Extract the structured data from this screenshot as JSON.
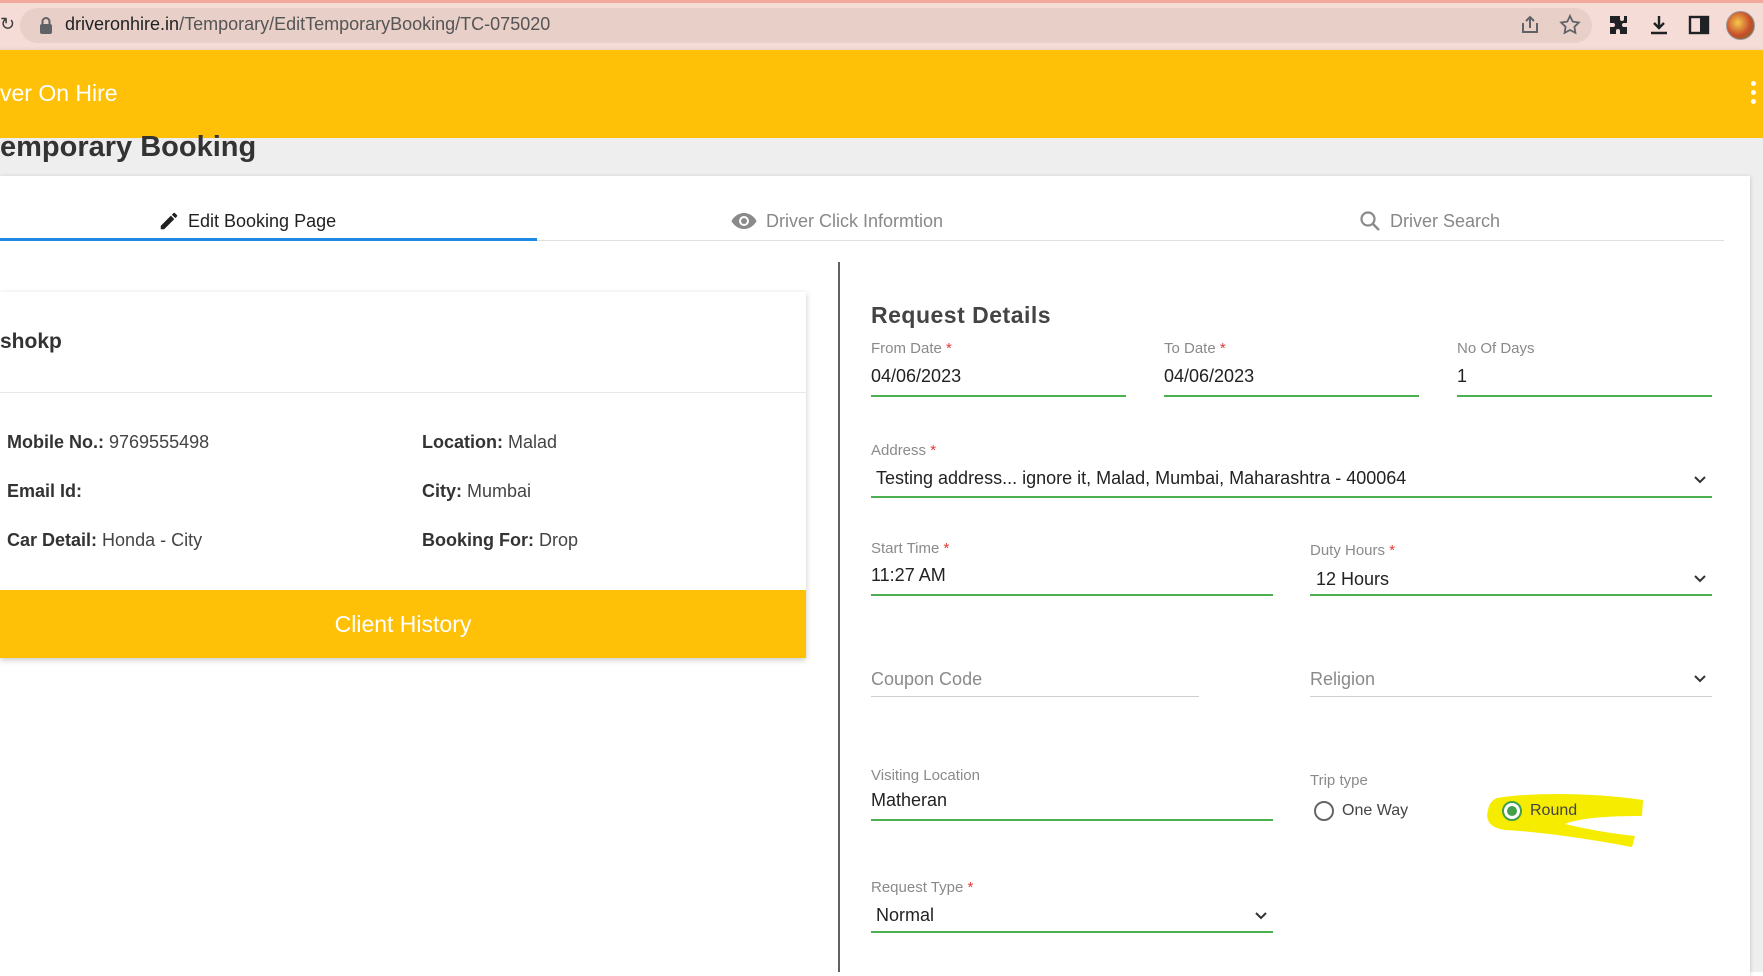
{
  "browser": {
    "url_host": "driveronhire.in",
    "url_path": "/Temporary/EditTemporaryBooking/TC-075020"
  },
  "app": {
    "title": "ver On Hire"
  },
  "page": {
    "title": "emporary Booking"
  },
  "tabs": [
    {
      "label": "Edit Booking Page",
      "icon": "pencil-icon",
      "active": true
    },
    {
      "label": "Driver Click Informtion",
      "icon": "eye-icon",
      "active": false
    },
    {
      "label": "Driver Search",
      "icon": "search-icon",
      "active": false
    }
  ],
  "client": {
    "name": "shokp",
    "mobile_label": "Mobile No.:",
    "mobile": "9769555498",
    "email_label": "Email Id:",
    "email": "",
    "car_label": "Car Detail:",
    "car": "Honda - City",
    "location_label": "Location:",
    "location": "Malad",
    "city_label": "City:",
    "city": "Mumbai",
    "booking_for_label": "Booking For:",
    "booking_for": "Drop",
    "history_button": "Client History"
  },
  "form": {
    "title": "Request Details",
    "from_date": {
      "label": "From Date",
      "value": "04/06/2023"
    },
    "to_date": {
      "label": "To Date",
      "value": "04/06/2023"
    },
    "no_of_days": {
      "label": "No Of Days",
      "value": "1"
    },
    "address": {
      "label": "Address",
      "value": "Testing address... ignore it, Malad, Mumbai, Maharashtra - 400064"
    },
    "start_time": {
      "label": "Start Time",
      "value": "11:27 AM"
    },
    "duty_hours": {
      "label": "Duty Hours",
      "value": "12 Hours"
    },
    "coupon_code": {
      "placeholder": "Coupon Code"
    },
    "religion": {
      "placeholder": "Religion"
    },
    "visiting_location": {
      "label": "Visiting Location",
      "value": "Matheran"
    },
    "trip_type": {
      "label": "Trip type",
      "options": [
        "One Way",
        "Round"
      ],
      "selected": "Round"
    },
    "request_type": {
      "label": "Request Type",
      "value": "Normal"
    },
    "required_mark": "*"
  },
  "colors": {
    "header": "#ffc107",
    "accent_green": "#4caf50",
    "tab_underline": "#1e88e5",
    "required": "#e53935",
    "highlight": "#f5ec00"
  }
}
